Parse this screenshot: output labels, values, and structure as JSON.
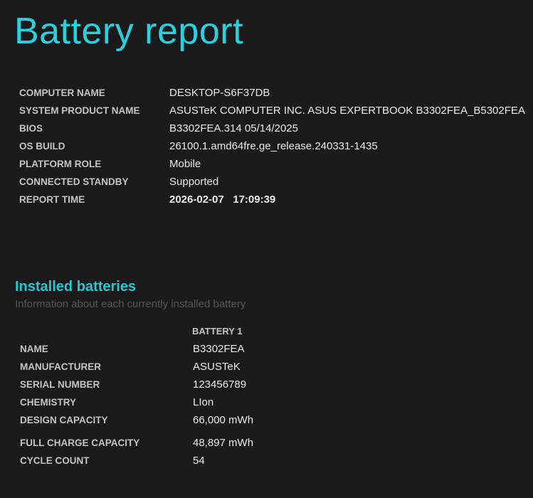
{
  "title": "Battery report",
  "system": [
    {
      "label": "COMPUTER NAME",
      "value": "DESKTOP-S6F37DB"
    },
    {
      "label": "SYSTEM PRODUCT NAME",
      "value": "ASUSTeK COMPUTER INC. ASUS EXPERTBOOK B3302FEA_B5302FEA"
    },
    {
      "label": "BIOS",
      "value": "B3302FEA.314 05/14/2025"
    },
    {
      "label": "OS BUILD",
      "value": "26100.1.amd64fre.ge_release.240331-1435"
    },
    {
      "label": "PLATFORM ROLE",
      "value": "Mobile"
    },
    {
      "label": "CONNECTED STANDBY",
      "value": "Supported"
    },
    {
      "label": "REPORT TIME",
      "value": "2026-02-07   17:09:39"
    }
  ],
  "installed": {
    "heading": "Installed batteries",
    "subtitle": "Information about each currently installed battery",
    "column": "BATTERY 1",
    "rows": [
      {
        "label": "NAME",
        "value": "B3302FEA"
      },
      {
        "label": "MANUFACTURER",
        "value": "ASUSTeK"
      },
      {
        "label": "SERIAL NUMBER",
        "value": "123456789"
      },
      {
        "label": "CHEMISTRY",
        "value": "LIon"
      },
      {
        "label": "DESIGN CAPACITY",
        "value": "66,000 mWh"
      },
      {
        "label": "FULL CHARGE CAPACITY",
        "value": "48,897 mWh"
      },
      {
        "label": "CYCLE COUNT",
        "value": "54"
      }
    ]
  }
}
